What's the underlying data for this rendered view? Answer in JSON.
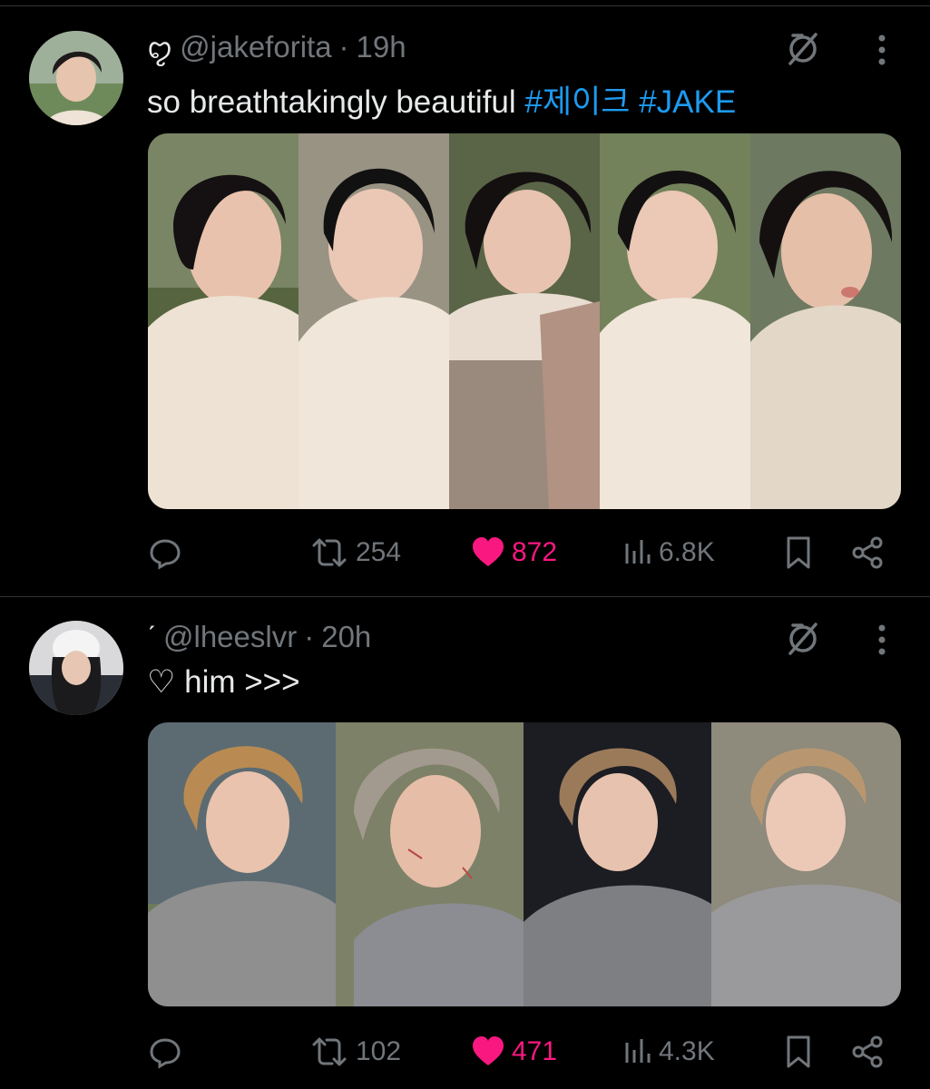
{
  "posts": [
    {
      "author_glyph": "ꨄ",
      "handle": "@jakeforita",
      "separator": "·",
      "time": "19h",
      "text": "so breathtakingly beautiful",
      "hashtags": [
        "#제이크",
        "#JAKE"
      ],
      "stats": {
        "retweets": "254",
        "likes": "872",
        "views": "6.8K"
      },
      "liked": true
    },
    {
      "author_glyph": "ˊ",
      "handle": "@lheeslvr",
      "separator": "·",
      "time": "20h",
      "text": "♡ him >>>",
      "hashtags": [],
      "stats": {
        "retweets": "102",
        "likes": "471",
        "views": "4.3K"
      },
      "liked": true
    }
  ],
  "icons": [
    "reply-icon",
    "retweet-icon",
    "heart-icon",
    "views-icon",
    "bookmark-icon",
    "share-icon",
    "mute-icon",
    "more-icon"
  ],
  "colors": {
    "background": "#000000",
    "text": "#e7e9ea",
    "muted": "#71767b",
    "hashtag": "#1d9bf0",
    "like": "#f91880",
    "divider": "#2f3336"
  }
}
